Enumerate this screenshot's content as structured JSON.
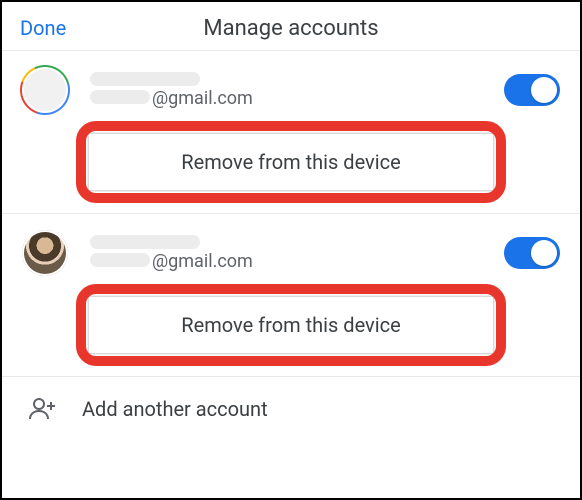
{
  "header": {
    "done_label": "Done",
    "title": "Manage accounts"
  },
  "accounts": [
    {
      "email_domain": "@gmail.com",
      "toggle_on": true,
      "remove_label": "Remove from this device",
      "avatar_kind": "google-ring"
    },
    {
      "email_domain": "@gmail.com",
      "toggle_on": true,
      "remove_label": "Remove from this device",
      "avatar_kind": "photo"
    }
  ],
  "add_account": {
    "label": "Add another account",
    "icon": "person-add-icon"
  },
  "colors": {
    "accent": "#1a73e8",
    "highlight": "#e8362d"
  }
}
